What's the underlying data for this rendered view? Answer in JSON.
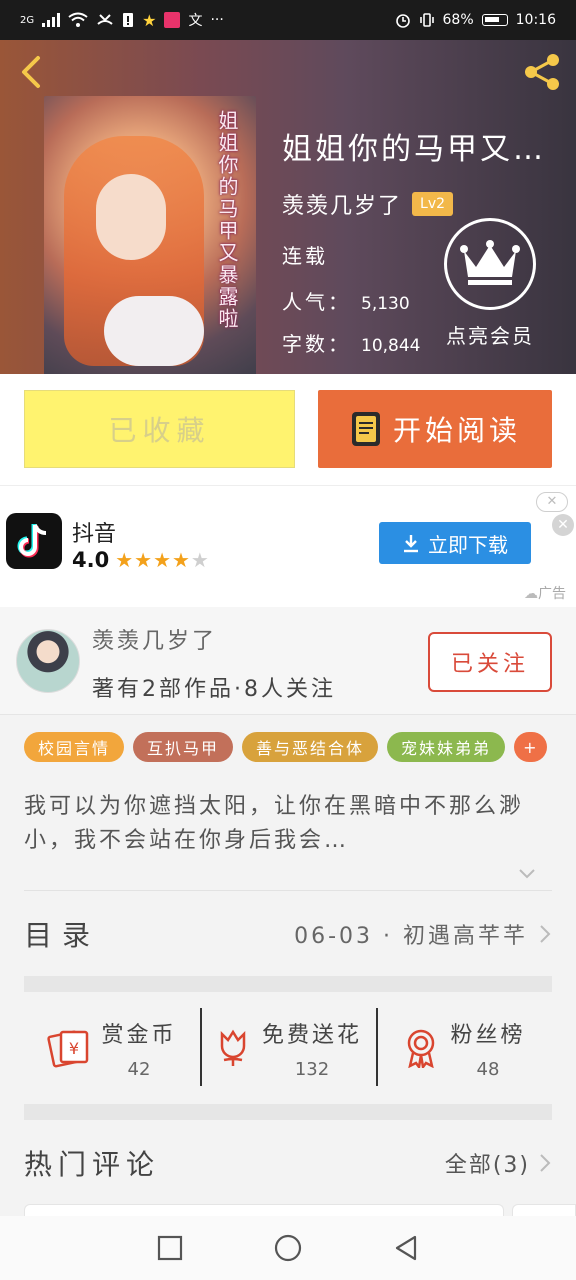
{
  "status_bar": {
    "network": "2G",
    "battery": "68%",
    "time": "10:16"
  },
  "book": {
    "title": "姐姐你的马甲又…",
    "cover_title": "姐姐你的马甲又暴露啦",
    "author": "羡羡几岁了",
    "level": "Lv2",
    "status": "连载",
    "popularity_label": "人气：",
    "popularity": "5,130",
    "words_label": "字数：",
    "words": "10,844",
    "vip_label": "点亮会员"
  },
  "actions": {
    "collected_label": "已收藏",
    "read_label": "开始阅读"
  },
  "ad": {
    "app_name": "抖音",
    "rating": "4.0",
    "download_label": "立即下载",
    "ad_tag": "广告",
    "close_icon": "close-icon"
  },
  "author_section": {
    "name": "羡羡几岁了",
    "info": "著有2部作品·8人关注",
    "follow_label": "已关注"
  },
  "tags": [
    {
      "label": "校园言情",
      "color": "#f2a63c"
    },
    {
      "label": "互扒马甲",
      "color": "#c2705a"
    },
    {
      "label": "善与恶结合体",
      "color": "#d8a23c"
    },
    {
      "label": "宠妹妹弟弟",
      "color": "#8cb84e"
    },
    {
      "label": "+",
      "color": "#ef7046"
    }
  ],
  "synopsis": "我可以为你遮挡太阳，让你在黑暗中不那么渺小，我不会站在你身后我会…",
  "catalog": {
    "label": "目录",
    "latest": "06-03 · 初遇高芊芊"
  },
  "stats": [
    {
      "label": "赏金币",
      "value": "42",
      "icon": "red-envelope-icon"
    },
    {
      "label": "免费送花",
      "value": "132",
      "icon": "flower-icon"
    },
    {
      "label": "粉丝榜",
      "value": "48",
      "icon": "medal-icon"
    }
  ],
  "comments": {
    "label": "热门评论",
    "all_label": "全部(3)"
  },
  "colors": {
    "accent": "#e96d3b",
    "collected_bg": "#fff36f",
    "follow": "#d94a3a",
    "download": "#2b8fe3"
  }
}
